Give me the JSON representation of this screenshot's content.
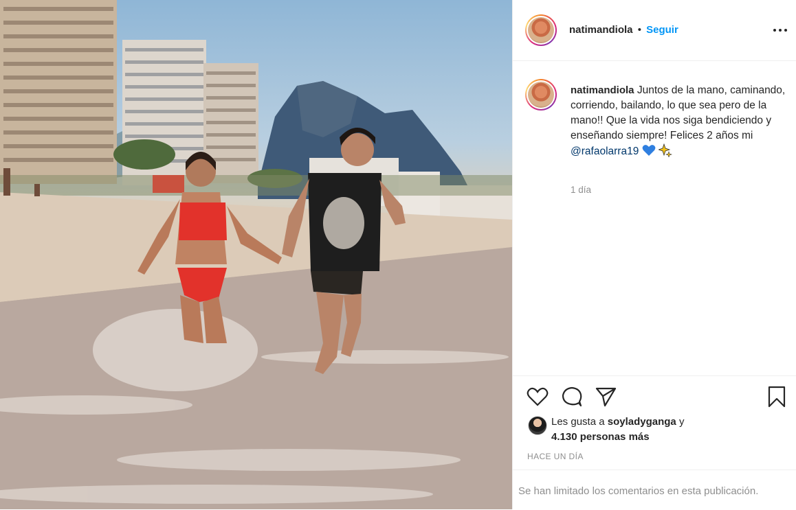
{
  "post": {
    "image_alt": "",
    "author": "natimandiola",
    "separator": "•",
    "follow_label": "Seguir",
    "more_icon": "more-options-icon",
    "caption": {
      "username": "natimandiola",
      "text": " Juntos de la mano, caminando, corriendo, bailando, lo que sea pero de la mano!! Que la vida nos siga bendiciendo y enseñando siempre! Felices 2 años mi ",
      "mention": "@rafaolarra19",
      "emojis": [
        "blue-heart-emoji",
        "sparkles-emoji"
      ],
      "time": "1 día"
    },
    "actions": {
      "like_icon": "heart-icon",
      "comment_icon": "comment-icon",
      "share_icon": "send-icon",
      "save_icon": "bookmark-icon"
    },
    "likes": {
      "prefix": "Les gusta a ",
      "liker": "soyladyganga",
      "conjunction": " y",
      "others": "4.130 personas más"
    },
    "posted_ago": "HACE UN DÍA",
    "comments_limited": "Se han limitado los comentarios en esta publicación."
  },
  "colors": {
    "link": "#0095f6",
    "mention": "#00376b",
    "secondary_text": "#8e8e8e",
    "primary_text": "#262626",
    "border": "#efefef"
  }
}
